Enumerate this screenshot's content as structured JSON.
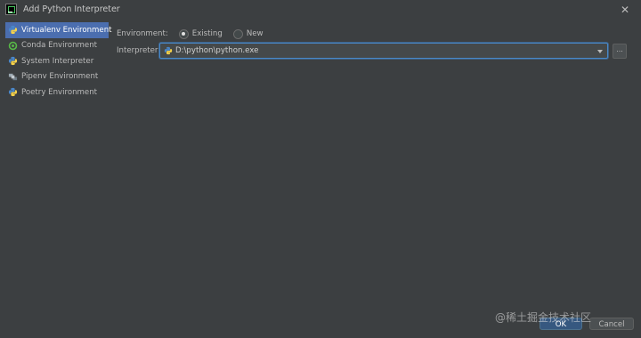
{
  "window": {
    "title": "Add Python Interpreter"
  },
  "sidebar": {
    "items": [
      {
        "label": "Virtualenv Environment",
        "icon": "virtualenv-icon",
        "selected": true
      },
      {
        "label": "Conda Environment",
        "icon": "conda-icon",
        "selected": false
      },
      {
        "label": "System Interpreter",
        "icon": "python-icon",
        "selected": false
      },
      {
        "label": "Pipenv Environment",
        "icon": "pipenv-icon",
        "selected": false
      },
      {
        "label": "Poetry Environment",
        "icon": "poetry-icon",
        "selected": false
      }
    ]
  },
  "form": {
    "environment_label": "Environment:",
    "environment_options": [
      {
        "label": "Existing",
        "checked": true
      },
      {
        "label": "New",
        "checked": false
      }
    ],
    "interpreter_label": "Interpreter:",
    "interpreter_value": "D:\\python\\python.exe",
    "browse_label": "..."
  },
  "buttons": {
    "ok": "OK",
    "cancel": "Cancel"
  },
  "watermark": "@稀土掘金技术社区",
  "colors": {
    "background": "#3c3f41",
    "selection": "#4b6eaf",
    "focus": "#4a88c7",
    "ok_button": "#365880"
  }
}
